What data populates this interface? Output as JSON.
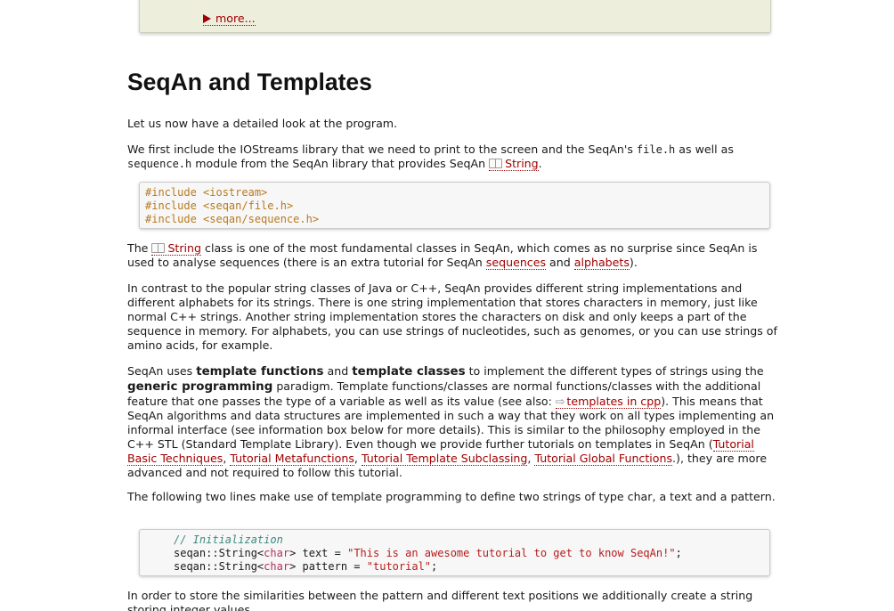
{
  "more_box": {
    "label": "more..."
  },
  "section": {
    "title": "SeqAn and Templates"
  },
  "para1": {
    "text": "Let us now have a detailed look at the program."
  },
  "para2": {
    "a": "We first include the IOStreams library that we need to print to the screen and the SeqAn's ",
    "code1": "file.h",
    "b": " as well as ",
    "code2": "sequence.h",
    "c": " module from the SeqAn library that provides SeqAn ",
    "link": "String",
    "d": "."
  },
  "code1": {
    "lines": [
      "#include <iostream>",
      "#include <seqan/file.h>",
      "#include <seqan/sequence.h>"
    ]
  },
  "para3": {
    "a": "The ",
    "link1": "String",
    "b": " class is one of the most fundamental classes in SeqAn, which comes as no surprise since SeqAn is used to analyse sequences (there is an extra tutorial for SeqAn ",
    "link2": "sequences",
    "c": " and ",
    "link3": "alphabets",
    "d": ")."
  },
  "para4": {
    "text": "In contrast to the popular string classes of Java or C++, SeqAn provides different string implementations and different alphabets for its strings. There is one string implementation that stores characters in memory, just like normal C++ strings. Another string implementation stores the characters on disk and only keeps a part of the sequence in memory. For alphabets, you can use strings of nucleotides, such as genomes, or you can use strings of amino acids, for example."
  },
  "para5": {
    "a": "SeqAn uses ",
    "bold1": "template functions",
    "b": " and ",
    "bold2": "template classes",
    "c": " to implement the different types of strings using the ",
    "bold3": "generic programming",
    "d": " paradigm. Template functions/classes are normal functions/classes with the additional feature that one passes the type of a variable as well as its value (see also: ",
    "link1": "templates in cpp",
    "e": "). This means that SeqAn algorithms and data structures are implemented in such a way that they work on all types implementing an informal interface (see information box below for more details). This is similar to the philosophy employed in the C++ STL (Standard Template Library). Even though we provide further tutorials on templates in SeqAn (",
    "link2": "Tutorial Basic Techniques",
    "f": ", ",
    "link3": "Tutorial Metafunctions",
    "g": ", ",
    "link4": "Tutorial Template Subclassing",
    "h": ", ",
    "link5": "Tutorial Global Functions",
    "i": ".), they are more advanced and not required to follow this tutorial."
  },
  "para6": {
    "text": "The following two lines make use of template programming to define two strings of type char, a text and a pattern."
  },
  "code2": {
    "comment": "// Initialization",
    "l2_ns": "seqan::String<",
    "l2_ty": "char",
    "l2_mid": "> text = ",
    "l2_str": "\"This is an awesome tutorial to get to know SeqAn!\"",
    "l2_end": ";",
    "l3_ns": "seqan::String<",
    "l3_ty": "char",
    "l3_mid": "> pattern = ",
    "l3_str": "\"tutorial\"",
    "l3_end": ";"
  },
  "para7": {
    "text": "In order to store the similarities between the pattern and different text positions we additionally create a string storing integer values."
  },
  "colors": {
    "link": "#a00000",
    "more_box_bg": "#eeeedd",
    "code_bg": "#f7f7f7",
    "preprocessor": "#b87a1f",
    "comment": "#3d8a80",
    "type": "#b03060",
    "string": "#b71c1c"
  }
}
